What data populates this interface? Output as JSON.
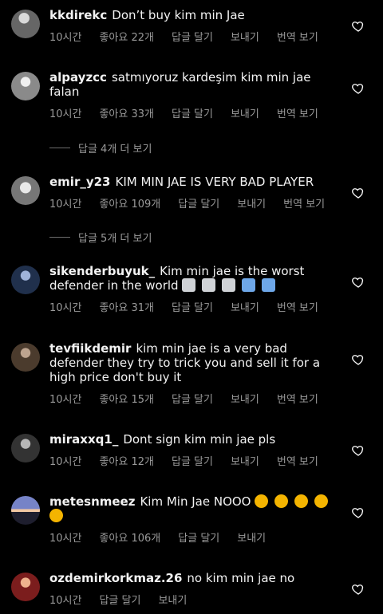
{
  "comments": [
    {
      "user": "kkdirekc",
      "text": "Don’t buy kim min Jae",
      "time": "10시간",
      "likes": "좋아요 22개",
      "reply": "답글 달기",
      "send": "보내기",
      "translate": "번역 보기",
      "emojis": []
    },
    {
      "user": "alpayzcc",
      "text": "satmıyoruz kardeşim kim min jae falan",
      "time": "10시간",
      "likes": "좋아요 33개",
      "reply": "답글 달기",
      "send": "보내기",
      "translate": "번역 보기",
      "emojis": []
    },
    {
      "user": "emir_y23",
      "text": "KIM MIN JAE IS VERY BAD PLAYER",
      "time": "10시간",
      "likes": "좋아요 109개",
      "reply": "답글 달기",
      "send": "보내기",
      "translate": "번역 보기",
      "emojis": []
    },
    {
      "user": "sikenderbuyuk_",
      "text": "Kim min jae is the worst defender in the world",
      "time": "10시간",
      "likes": "좋아요 31개",
      "reply": "답글 달기",
      "send": "보내기",
      "translate": "번역 보기",
      "emojis": [
        "wastebasket",
        "wastebasket",
        "wastebasket",
        "thumbs-up",
        "thumbs-up"
      ]
    },
    {
      "user": "tevfiikdemir",
      "text": "kim min jae is a very bad defender they try to trick you and sell it for a high price don't buy it",
      "time": "10시간",
      "likes": "좋아요 15개",
      "reply": "답글 달기",
      "send": "보내기",
      "translate": "번역 보기",
      "emojis": []
    },
    {
      "user": "miraxxq1_",
      "text": "Dont sign kim min jae pls",
      "time": "10시간",
      "likes": "좋아요 12개",
      "reply": "답글 달기",
      "send": "보내기",
      "translate": "번역 보기",
      "emojis": []
    },
    {
      "user": "metesnmeez",
      "text": "Kim Min Jae NOOO",
      "time": "10시간",
      "likes": "좋아요 106개",
      "reply": "답글 달기",
      "send": "보내기",
      "translate": "",
      "emojis": [
        "angry",
        "angry",
        "angry",
        "angry",
        "angry"
      ]
    },
    {
      "user": "ozdemirkorkmaz.26",
      "text": "no kim min jae no",
      "time": "10시간",
      "likes": "",
      "reply": "답글 달기",
      "send": "보내기",
      "translate": "",
      "emojis": []
    }
  ],
  "reply_threads": {
    "alpayzcc": "답글 4개 더 보기",
    "emir_y23": "답글 5개 더 보기"
  },
  "colors": {
    "background": "#000000",
    "text": "#f2f2f2",
    "meta": "#9a9a9a"
  }
}
